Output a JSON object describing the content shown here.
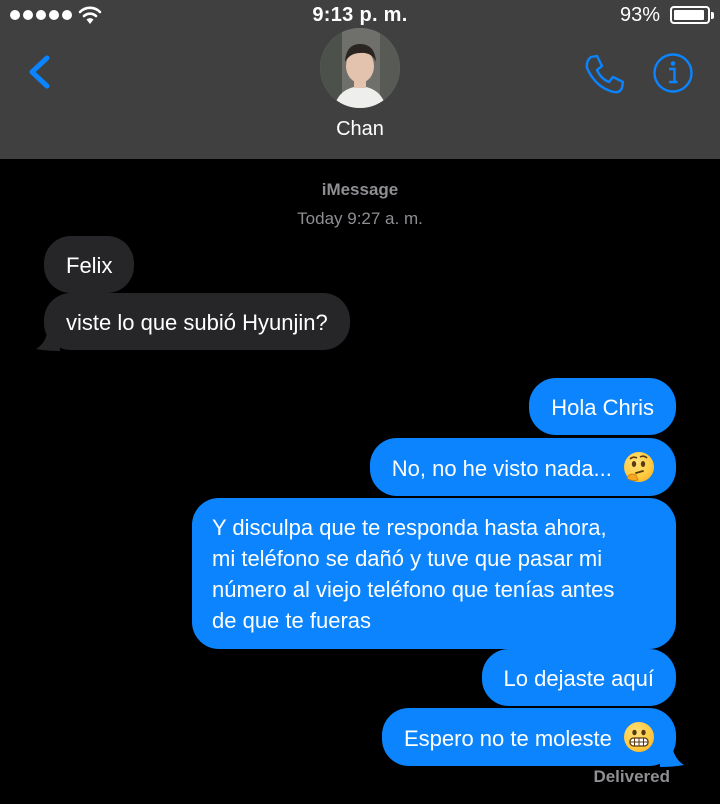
{
  "status_bar": {
    "time": "9:13 p. m.",
    "battery_percent": "93%",
    "battery_level": 0.93,
    "signal_bars": 5,
    "wifi_icon": "wifi-icon"
  },
  "header": {
    "contact_name": "Chan",
    "back_icon": "chevron-left-icon",
    "call_icon": "phone-icon",
    "info_icon": "info-icon",
    "accent_color": "#0a84ff"
  },
  "thread": {
    "service": "iMessage",
    "timestamp": "Today 9:27 a. m.",
    "messages": [
      {
        "direction": "incoming",
        "text": "Felix"
      },
      {
        "direction": "incoming",
        "text": "viste lo que subió Hyunjin?"
      },
      {
        "direction": "outgoing",
        "text": "Hola Chris"
      },
      {
        "direction": "outgoing",
        "text": "No, no he visto nada...",
        "emoji": "thinking-face"
      },
      {
        "direction": "outgoing",
        "lines": [
          "Y disculpa que te responda hasta ahora,",
          "mi teléfono se dañó y tuve que pasar mi",
          "número al viejo teléfono que tenías antes",
          "de que te fueras"
        ]
      },
      {
        "direction": "outgoing",
        "text": "Lo dejaste aquí"
      },
      {
        "direction": "outgoing",
        "text": "Espero no te moleste",
        "emoji": "grimacing-face"
      }
    ],
    "receipt": "Delivered",
    "incoming_color": "#262628",
    "outgoing_color": "#0b84fe"
  }
}
